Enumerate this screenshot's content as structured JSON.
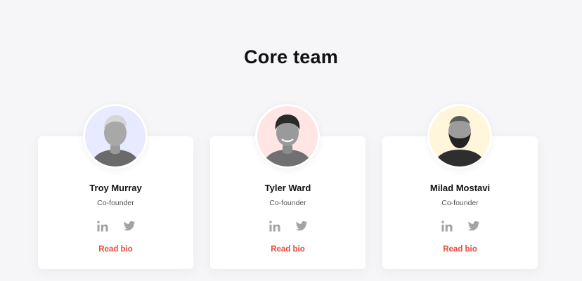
{
  "section": {
    "title": "Core team"
  },
  "colors": {
    "accent": "#e84a3b",
    "social_icon": "#a3a3a3",
    "background": "#f6f6f8"
  },
  "team": [
    {
      "name": "Troy Murray",
      "role": "Co-founder",
      "bio_label": "Read bio",
      "avatar_bg": "#e8eaff"
    },
    {
      "name": "Tyler Ward",
      "role": "Co-founder",
      "bio_label": "Read bio",
      "avatar_bg": "#ffe6e4"
    },
    {
      "name": "Milad Mostavi",
      "role": "Co-founder",
      "bio_label": "Read bio",
      "avatar_bg": "#fff6dc"
    }
  ],
  "icons": {
    "social_1": "linkedin-icon",
    "social_2": "twitter-icon"
  }
}
